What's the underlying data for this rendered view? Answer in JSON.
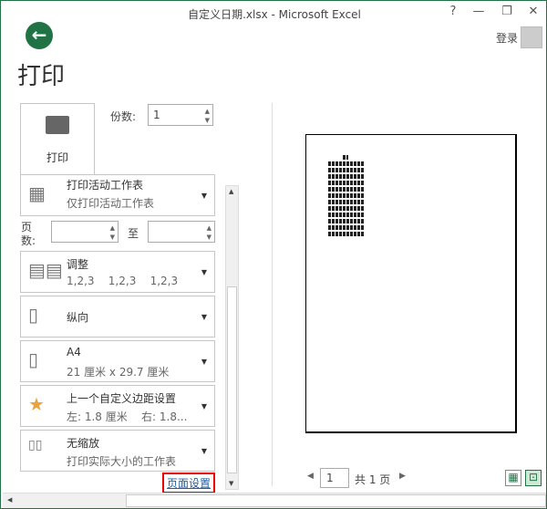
{
  "window": {
    "title": "自定义日期.xlsx - Microsoft Excel",
    "help": "?",
    "minimize": "—",
    "restore": "❐",
    "close": "✕",
    "login": "登录"
  },
  "page_title": "打印",
  "print_button": "打印",
  "copies": {
    "label": "份数:",
    "value": "1"
  },
  "pages": {
    "label": "页数:",
    "to": "至",
    "from_value": "",
    "to_value": ""
  },
  "settings": [
    {
      "title": "打印活动工作表",
      "subtitle": "仅打印活动工作表"
    },
    {
      "title": "调整",
      "subtitle": "1,2,3    1,2,3    1,2,3"
    },
    {
      "title": "纵向",
      "subtitle": ""
    },
    {
      "title": "A4",
      "subtitle": "21 厘米 x 29.7 厘米"
    },
    {
      "title": "上一个自定义边距设置",
      "subtitle": "左: 1.8 厘米    右: 1.8..."
    },
    {
      "title": "无缩放",
      "subtitle": "打印实际大小的工作表"
    }
  ],
  "page_setup_link": "页面设置",
  "preview": {
    "current_page": "1",
    "total": "共 1 页"
  }
}
